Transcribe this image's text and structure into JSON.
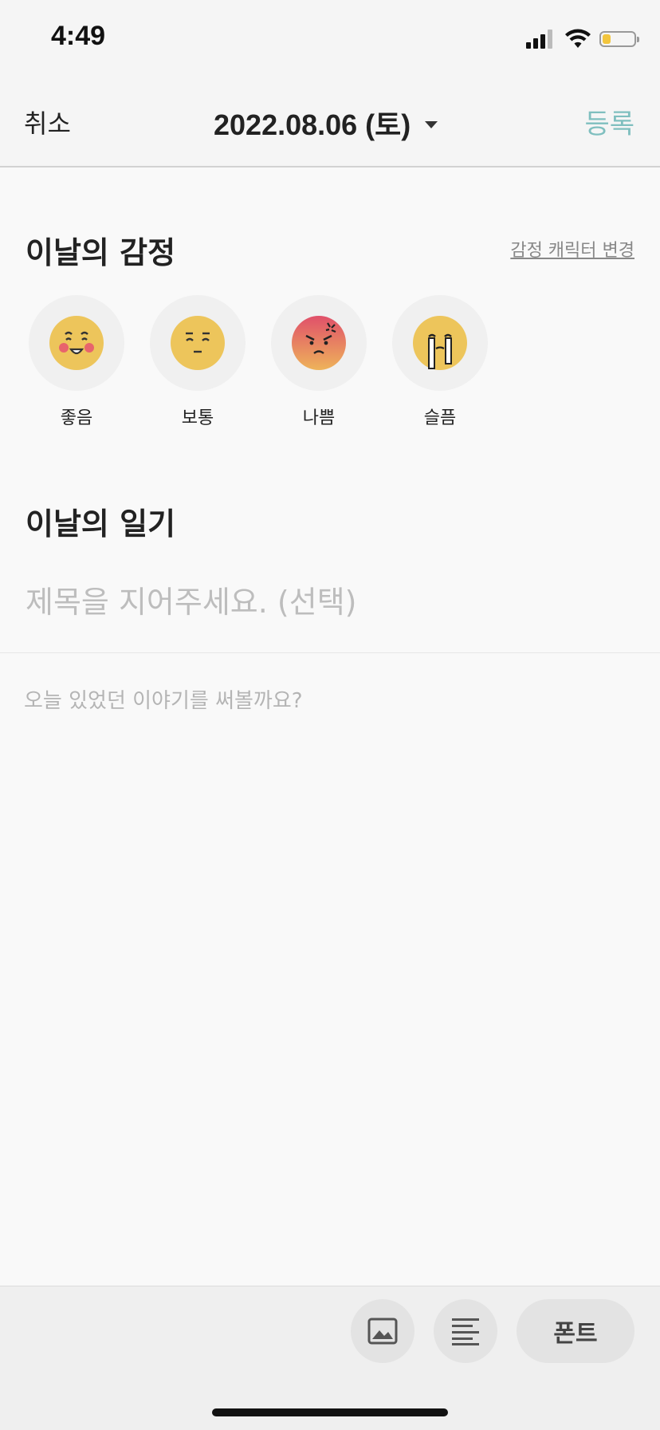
{
  "status_bar": {
    "time": "4:49",
    "battery_level": 0.25,
    "battery_color": "#f2c53d"
  },
  "nav": {
    "cancel_label": "취소",
    "date": "2022.08.06 (토)",
    "register_label": "등록",
    "accent_color": "#7fbfbf"
  },
  "emotion_section": {
    "title": "이날의 감정",
    "change_link": "감정 캐릭터 변경",
    "emotions": [
      {
        "label": "좋음",
        "icon": "happy-face-icon"
      },
      {
        "label": "보통",
        "icon": "neutral-face-icon"
      },
      {
        "label": "나쁨",
        "icon": "angry-face-icon"
      },
      {
        "label": "슬픔",
        "icon": "crying-face-icon"
      }
    ]
  },
  "diary_section": {
    "title": "이날의 일기",
    "title_placeholder": "제목을 지어주세요. (선택)",
    "body_placeholder": "오늘 있었던 이야기를 써볼까요?"
  },
  "toolbar": {
    "image_icon": "image-icon",
    "align_icon": "align-left-icon",
    "font_label": "폰트"
  }
}
